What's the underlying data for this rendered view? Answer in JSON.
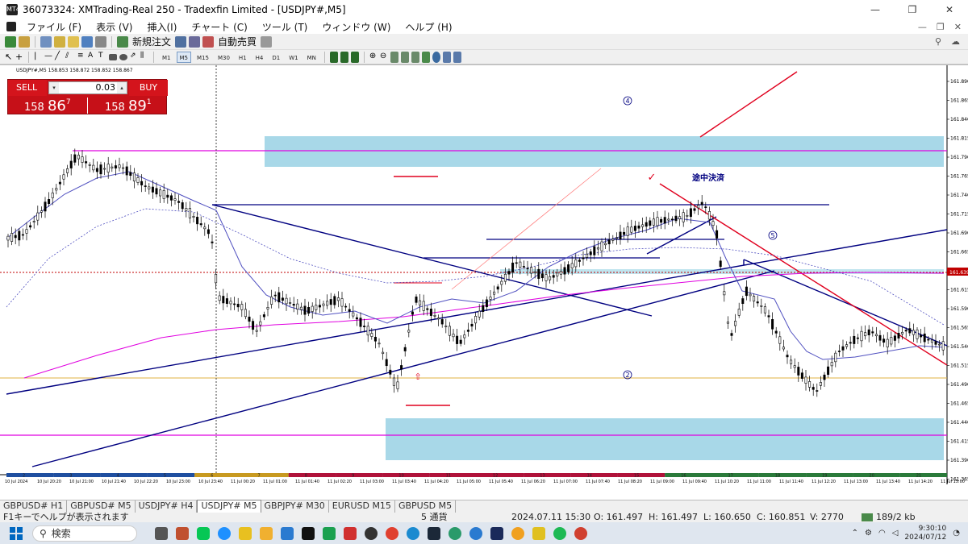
{
  "window": {
    "title": "36073324: XMTrading-Real 250 - Tradexfin Limited - [USDJPY#,M5]",
    "app_icon": "MT4",
    "controls": [
      "—",
      "❐",
      "✕"
    ]
  },
  "menu": {
    "items": [
      "ファイル (F)",
      "表示 (V)",
      "挿入(I)",
      "チャート (C)",
      "ツール (T)",
      "ウィンドウ (W)",
      "ヘルプ (H)"
    ],
    "mdi": [
      "—",
      "❐",
      "✕"
    ]
  },
  "toolbar": {
    "new_order": "新規注文",
    "auto_trade": "自動売買",
    "timeframes": [
      "M1",
      "M5",
      "M15",
      "M30",
      "H1",
      "H4",
      "D1",
      "W1",
      "MN"
    ],
    "active_timeframe": "M5"
  },
  "chart": {
    "header": "USDJPY#,M5  158.853 158.872 158.852 158.867",
    "current_price": "161.639",
    "annotations": {
      "marker4": "④",
      "marker2": "②",
      "marker5": "⑤",
      "note": "途中決済",
      "check": "✓",
      "arrow": "⇧"
    },
    "price_axis": [
      "161.890",
      "161.865",
      "161.840",
      "161.815",
      "161.790",
      "161.765",
      "161.740",
      "161.715",
      "161.690",
      "161.665",
      "161.615",
      "161.590",
      "161.565",
      "161.540",
      "161.515",
      "161.490",
      "161.465",
      "161.440",
      "161.415",
      "161.390",
      "161.365"
    ],
    "time_axis": [
      "10 Jul 2024",
      "10 Jul 20:20",
      "10 Jul 21:00",
      "10 Jul 21:40",
      "10 Jul 22:20",
      "10 Jul 23:00",
      "10 Jul 23:40",
      "11 Jul 00:20",
      "11 Jul 01:00",
      "11 Jul 01:40",
      "11 Jul 02:20",
      "11 Jul 03:00",
      "11 Jul 03:40",
      "11 Jul 04:20",
      "11 Jul 05:00",
      "11 Jul 05:40",
      "11 Jul 06:20",
      "11 Jul 07:00",
      "11 Jul 07:40",
      "11 Jul 08:20",
      "11 Jul 09:00",
      "11 Jul 09:40",
      "11 Jul 10:20",
      "11 Jul 11:00",
      "11 Jul 11:40",
      "11 Jul 12:20",
      "11 Jul 13:00",
      "11 Jul 13:40",
      "11 Jul 14:20",
      "11 Jul 15:00"
    ],
    "session_numbers": [
      "2",
      "3",
      "4",
      "5",
      "6",
      "7",
      "8",
      "9",
      "10",
      "11",
      "12",
      "13",
      "14",
      "15",
      "16",
      "17",
      "18",
      "19",
      "20",
      "21"
    ],
    "colors": {
      "bg": "#ffffff",
      "candle": "#000000",
      "trendline": "#000080",
      "red_line": "#e0001e",
      "magenta": "#e000e0",
      "zone": "#a8d8e8",
      "ma_blue": "#5050c0"
    }
  },
  "trade_panel": {
    "sell_label": "SELL",
    "buy_label": "BUY",
    "lot": "0.03",
    "sell_price_prefix": "158 ",
    "sell_price_big": "86",
    "sell_price_sup": "7",
    "buy_price_prefix": "158 ",
    "buy_price_big": "89",
    "buy_price_sup": "1"
  },
  "tabs": [
    "GBPUSD# H1",
    "GBPUSD# M5",
    "USDJPY# H4",
    "USDJPY# M5",
    "GBPJPY# M30",
    "EURUSD M15",
    "GBPUSD M5"
  ],
  "active_tab": "USDJPY# M5",
  "status": {
    "help": "F1キーでヘルプが表示されます",
    "currency": "5 通貨",
    "datetime": "2024.07.11 15:30",
    "open": "O: 161.497",
    "high": "H: 161.497",
    "low": "L: 160.650",
    "close": "C: 160.851",
    "volume": "V: 2770",
    "traffic": "189/2 kb"
  },
  "taskbar": {
    "search_placeholder": "検索",
    "time": "9:30:10",
    "date": "2024/07/12"
  }
}
